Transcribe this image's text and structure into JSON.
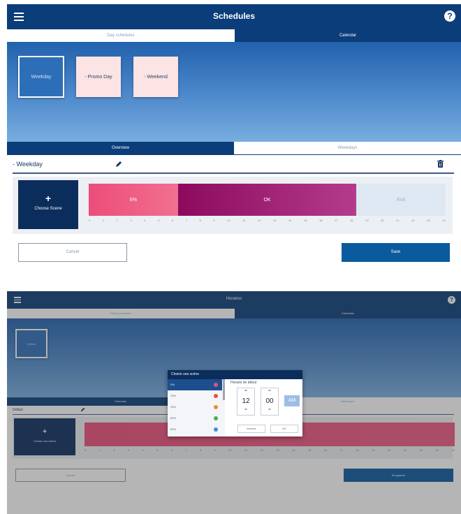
{
  "colors": {
    "header": "#0b3d7a",
    "accent": "#0a5a9e",
    "pink_card": "#fce4e4"
  },
  "screen1": {
    "header": {
      "title": "Schedules"
    },
    "tabs": [
      {
        "label": "Day schedules"
      },
      {
        "label": "Calendar"
      }
    ],
    "day_cards": [
      {
        "label": "Weekday",
        "selected": true
      },
      {
        "label": "- Promo Day",
        "selected": false
      },
      {
        "label": "- Weekend",
        "selected": false
      }
    ],
    "view_tabs": [
      {
        "label": "Overview"
      },
      {
        "label": "Weekdays"
      }
    ],
    "day_name": "- Weekday",
    "choose_scene": {
      "plus": "+",
      "label": "Choose Scene"
    },
    "timeline": {
      "segments": [
        {
          "label": "6%",
          "start": 0,
          "end": 6,
          "color": "#ec4d7a"
        },
        {
          "label": "OK",
          "start": 6,
          "end": 18,
          "color": "#8c0a5e"
        },
        {
          "label": "Exit",
          "start": 18,
          "end": 24,
          "color": "#dde8f2"
        }
      ],
      "hours": [
        "0",
        "1",
        "2",
        "3",
        "4",
        "5",
        "6",
        "7",
        "8",
        "9",
        "10",
        "11",
        "12",
        "13",
        "14",
        "15",
        "16",
        "17",
        "18",
        "19",
        "20",
        "21",
        "22",
        "23",
        "24"
      ]
    },
    "cancel_label": "Cancel",
    "save_label": "Save"
  },
  "screen2": {
    "header": {
      "title": "Horaires"
    },
    "tabs": [
      {
        "label": "Plans journaliers"
      },
      {
        "label": "Calendrier"
      }
    ],
    "day_card": {
      "label": "Defaut"
    },
    "view_tabs": [
      {
        "label": "Overview"
      },
      {
        "label": "Weekdays"
      }
    ],
    "day_name": "Defaut",
    "choose_scene": {
      "plus": "+",
      "label": "Choisir une scène"
    },
    "cancel_label": "Annuler",
    "save_label": "Enregistrer",
    "dialog": {
      "title": "Choisir une scène",
      "scenes": [
        {
          "label": "0%",
          "selected": true,
          "dot": "#ec4d7a"
        },
        {
          "label": "20%",
          "selected": false,
          "dot": "#e05050"
        },
        {
          "label": "40%",
          "selected": false,
          "dot": "#f08a2a"
        },
        {
          "label": "60%",
          "selected": false,
          "dot": "#4caf50"
        },
        {
          "label": "80%",
          "selected": false,
          "dot": "#3b8fd6"
        }
      ],
      "time_label": "Horaire de début",
      "hour": "12",
      "minute": "00",
      "ampm": "AM",
      "cancel_label": "Annuler",
      "ok_label": "OK"
    }
  }
}
